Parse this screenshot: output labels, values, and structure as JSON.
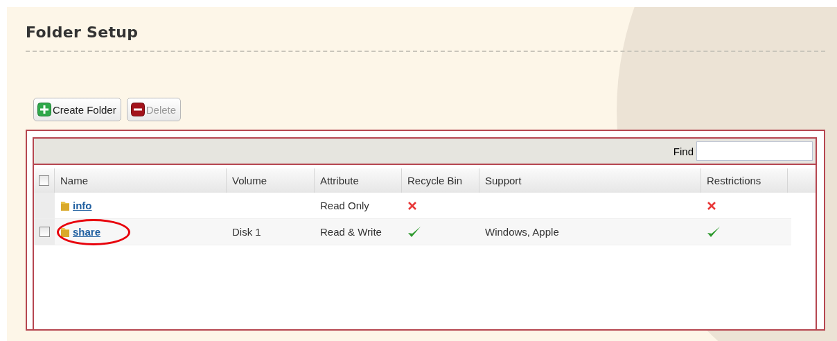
{
  "title": "Folder Setup",
  "toolbar": [
    {
      "kind": "add",
      "label": "Create Folder",
      "disabled": false
    },
    {
      "kind": "remove",
      "label": "Delete",
      "disabled": true
    }
  ],
  "find": {
    "label": "Find"
  },
  "table": {
    "columns": [
      "Name",
      "Volume",
      "Attribute",
      "Recycle Bin",
      "Support",
      "Restrictions"
    ],
    "header_checkbox": {
      "checked": false
    },
    "rows": [
      {
        "kind": "fixed",
        "name": "info",
        "volume": "",
        "attribute": "Read Only",
        "recycle_bin": false,
        "support": "",
        "restrictions": false,
        "circled": false
      },
      {
        "kind": "selectable",
        "name": "share",
        "volume": "Disk 1",
        "attribute": "Read & Write",
        "recycle_bin": true,
        "support": "Windows, Apple",
        "restrictions": true,
        "circled": true
      }
    ]
  }
}
